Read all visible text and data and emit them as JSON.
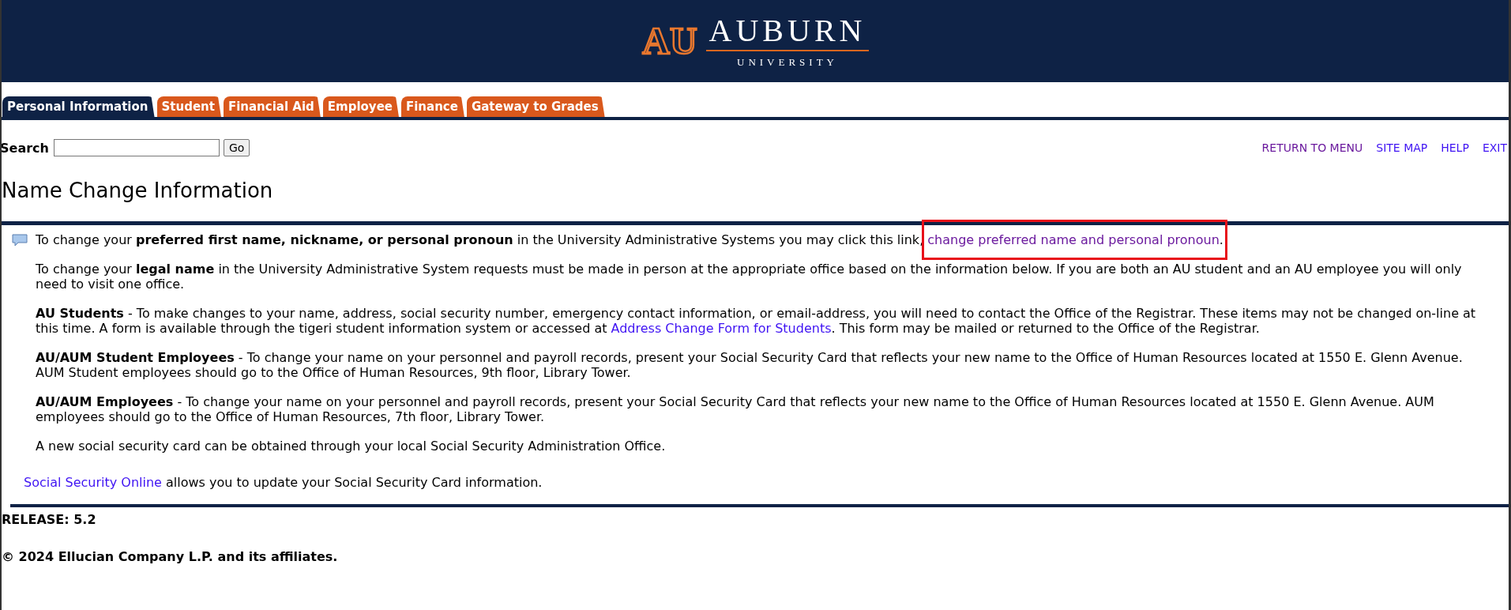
{
  "header": {
    "monogram": "AU",
    "name": "AUBURN",
    "subtitle": "UNIVERSITY"
  },
  "tabs": [
    {
      "label": "Personal Information",
      "selected": true
    },
    {
      "label": "Student",
      "selected": false
    },
    {
      "label": "Financial Aid",
      "selected": false
    },
    {
      "label": "Employee",
      "selected": false
    },
    {
      "label": "Finance",
      "selected": false
    },
    {
      "label": "Gateway to Grades",
      "selected": false
    }
  ],
  "search": {
    "label": "Search",
    "button": "Go"
  },
  "nav_links": [
    {
      "label": "RETURN TO MENU",
      "visited": true
    },
    {
      "label": "SITE MAP",
      "visited": false
    },
    {
      "label": "HELP",
      "visited": false
    },
    {
      "label": "EXIT",
      "visited": false
    }
  ],
  "title": "Name Change Information",
  "paragraphs": [
    {
      "kind": "note",
      "segments": [
        {
          "kind": "text",
          "text": "To change your **preferred first name, nickname, or personal pronoun** in the University Administrative Systems you may click this link, "
        },
        {
          "kind": "link",
          "label": "change preferred name and personal pronoun",
          "visited": true,
          "highlighted": true
        },
        {
          "kind": "text",
          "text": "."
        }
      ]
    },
    {
      "kind": "indented",
      "segments": [
        {
          "kind": "text",
          "text": "To change your **legal name** in the University Administrative System requests must be made in person at the appropriate office based on the information below. If you are both an AU student and an AU employee you will only need to visit one office."
        }
      ]
    },
    {
      "kind": "indented",
      "segments": [
        {
          "kind": "text",
          "text": "**AU Students** - To make changes to your name, address, social security number, emergency contact information, or email-address, you will need to contact the Office of the Registrar. These items may not be changed on-line at this time. A form is available through the tigeri student information system or accessed at "
        },
        {
          "kind": "link",
          "label": "Address Change Form for Students",
          "visited": false,
          "highlighted": false
        },
        {
          "kind": "text",
          "text": ". This form may be mailed or returned to the Office of the Registrar."
        }
      ]
    },
    {
      "kind": "indented",
      "segments": [
        {
          "kind": "text",
          "text": "**AU/AUM Student Employees** - To change your name on your personnel and payroll records, present your Social Security Card that reflects your new name to the Office of Human Resources located at 1550 E. Glenn Avenue. AUM Student employees should go to the Office of Human Resources, 9th floor, Library Tower."
        }
      ]
    },
    {
      "kind": "indented",
      "segments": [
        {
          "kind": "text",
          "text": "**AU/AUM Employees** - To change your name on your personnel and payroll records, present your Social Security Card that reflects your new name to the Office of Human Resources located at 1550 E. Glenn Avenue. AUM employees should go to the Office of Human Resources, 7th floor, Library Tower."
        }
      ]
    },
    {
      "kind": "indented",
      "segments": [
        {
          "kind": "text",
          "text": "A new social security card can be obtained through your local Social Security Administration Office."
        }
      ]
    },
    {
      "kind": "plain",
      "segments": [
        {
          "kind": "link",
          "label": "Social Security Online",
          "visited": false,
          "highlighted": false
        },
        {
          "kind": "text",
          "text": " allows you to update your Social Security Card information."
        }
      ]
    }
  ],
  "footer": {
    "release": "RELEASE: 5.2",
    "copyright": "© 2024 Ellucian Company L.P. and its affiliates."
  }
}
